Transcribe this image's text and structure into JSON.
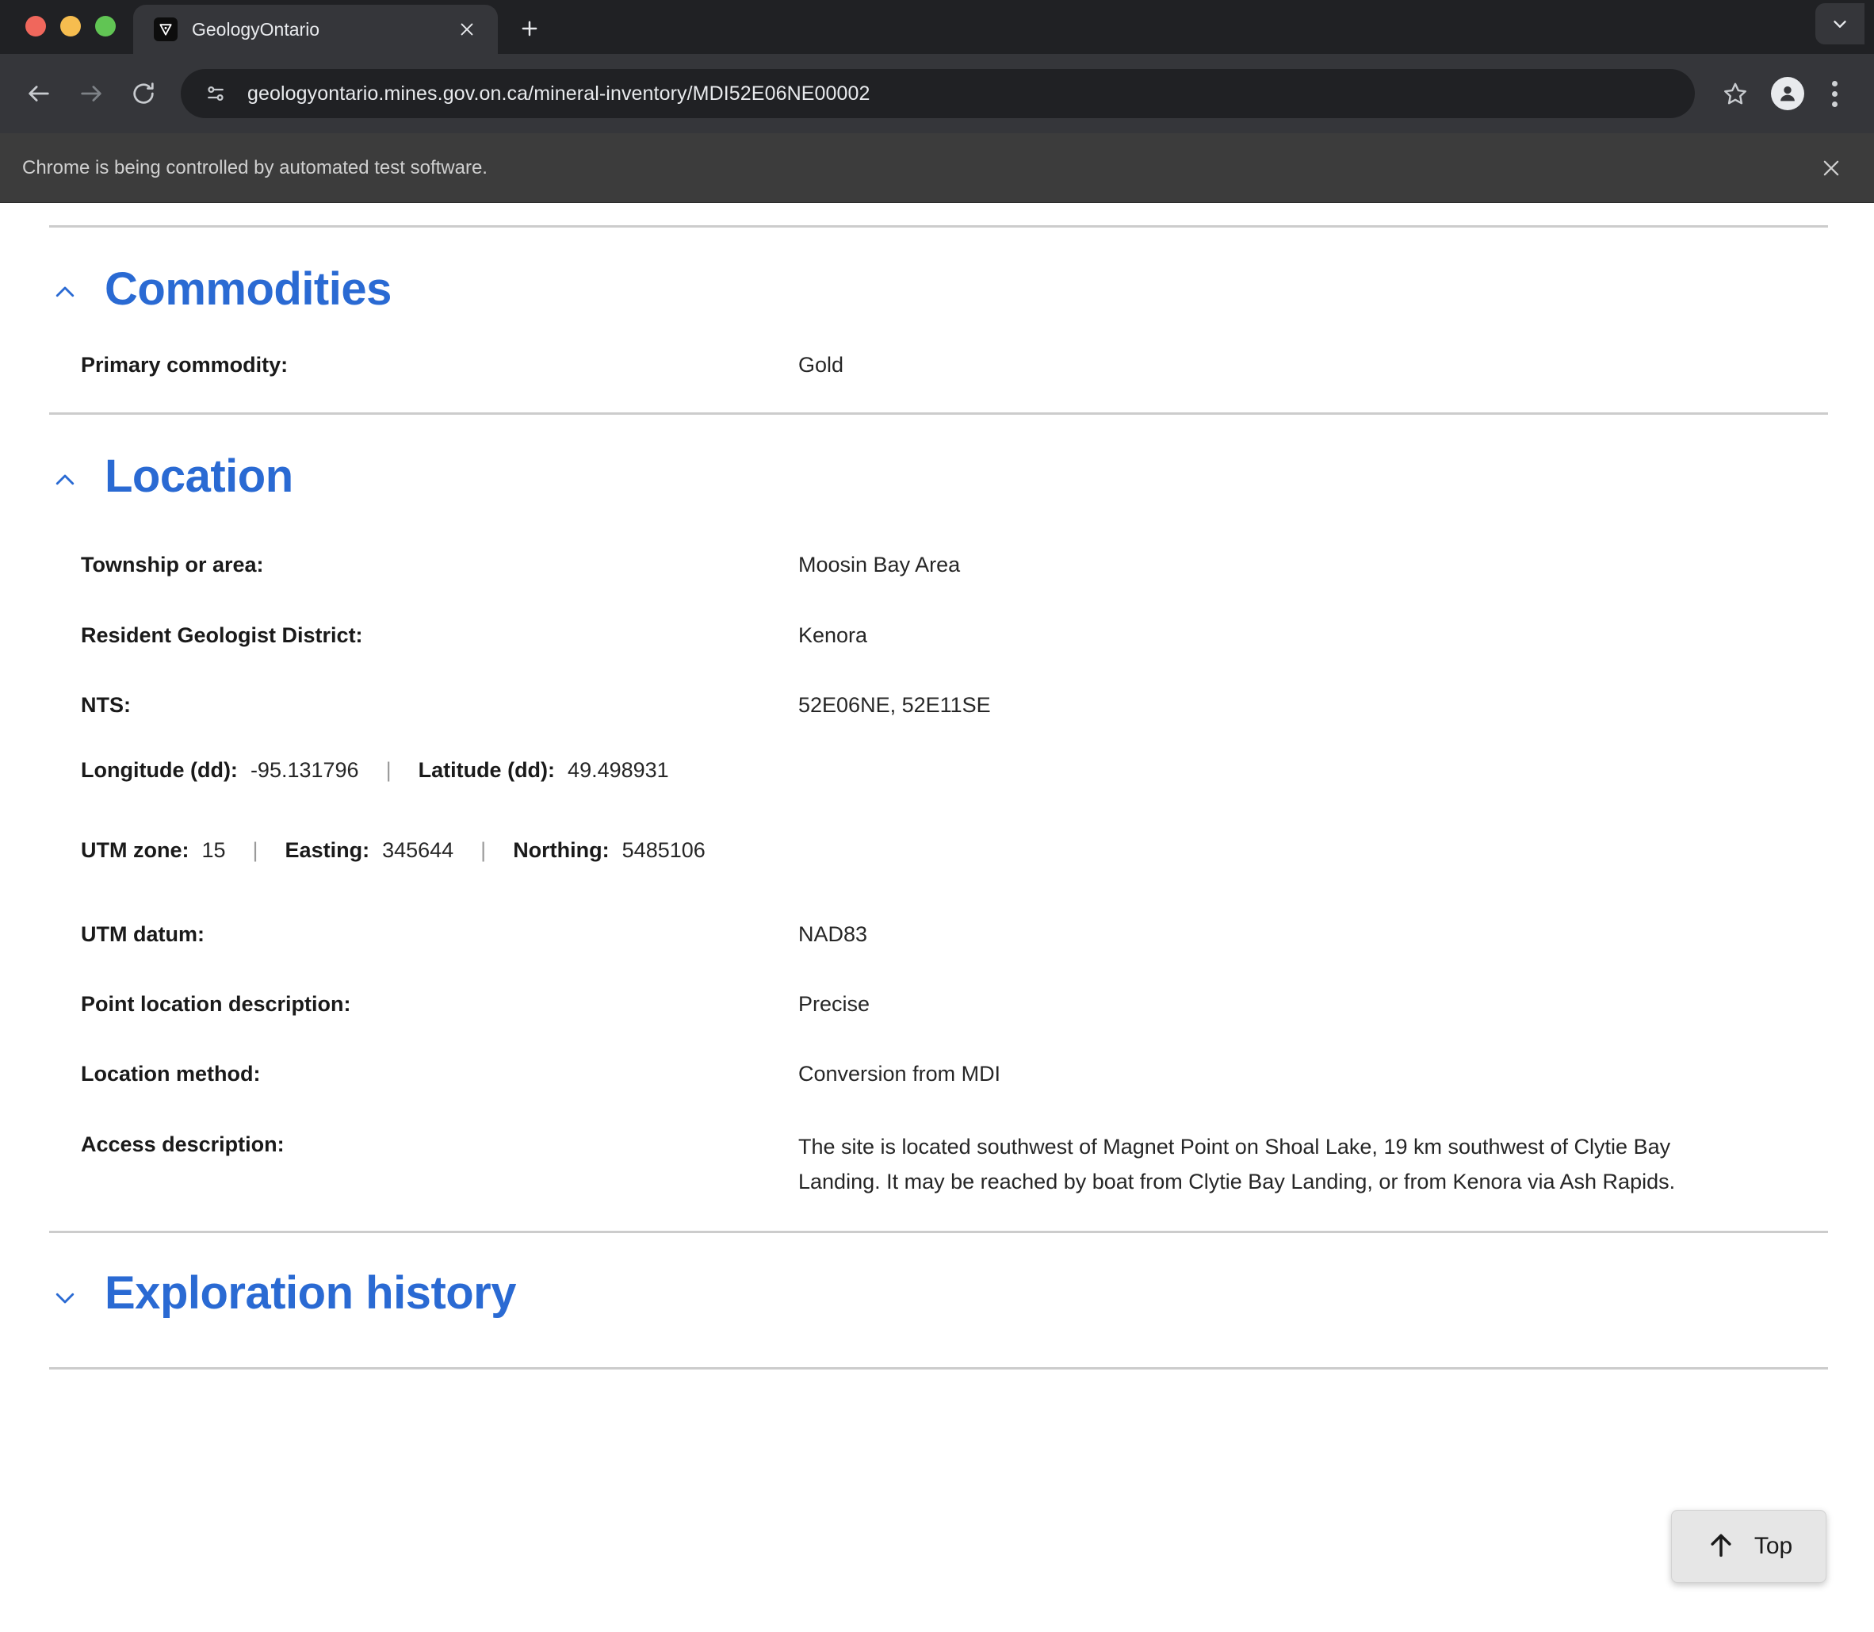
{
  "browser": {
    "tab": {
      "title": "GeologyOntario",
      "favicon_icon": "geology-ontario-favicon",
      "close_icon": "close-icon"
    },
    "new_tab_icon": "plus-icon",
    "tab_search_icon": "chevron-down-icon",
    "nav": {
      "back_icon": "back-arrow-icon",
      "forward_icon": "forward-arrow-icon",
      "reload_icon": "reload-icon"
    },
    "omnibox": {
      "site_info_icon": "site-settings-icon",
      "url": "geologyontario.mines.gov.on.ca/mineral-inventory/MDI52E06NE00002",
      "bookmark_icon": "star-icon"
    },
    "profile_icon": "profile-avatar-icon",
    "menu_icon": "kebab-menu-icon",
    "infobar": {
      "message": "Chrome is being controlled by automated test software.",
      "close_icon": "close-icon"
    }
  },
  "page": {
    "sections": [
      {
        "id": "commodities",
        "title": "Commodities",
        "expanded": true,
        "toggle_icon": "chevron-up-icon",
        "rows": [
          {
            "label": "Primary commodity:",
            "value": "Gold"
          }
        ]
      },
      {
        "id": "location",
        "title": "Location",
        "expanded": true,
        "toggle_icon": "chevron-up-icon",
        "rows": [
          {
            "label": "Township or area:",
            "value": "Moosin Bay Area"
          },
          {
            "label": "Resident Geologist District:",
            "value": "Kenora"
          },
          {
            "label": "NTS:",
            "value": "52E06NE, 52E11SE"
          }
        ],
        "coordinates": {
          "longitude_label": "Longitude (dd):",
          "longitude_value": "-95.131796",
          "separator": "|",
          "latitude_label": "Latitude (dd):",
          "latitude_value": "49.498931"
        },
        "utm": {
          "zone_label": "UTM zone:",
          "zone_value": "15",
          "separator": "|",
          "easting_label": "Easting:",
          "easting_value": "345644",
          "northing_label": "Northing:",
          "northing_value": "5485106"
        },
        "rows_after": [
          {
            "label": "UTM datum:",
            "value": "NAD83"
          },
          {
            "label": "Point location description:",
            "value": "Precise"
          },
          {
            "label": "Location method:",
            "value": "Conversion from MDI"
          },
          {
            "label": "Access description:",
            "value": "The site is located southwest of Magnet Point on Shoal Lake, 19 km southwest of Clytie Bay Landing. It may be reached by boat from Clytie Bay Landing, or from Kenora via Ash Rapids."
          }
        ]
      },
      {
        "id": "exploration-history",
        "title": "Exploration history",
        "expanded": false,
        "toggle_icon": "chevron-down-icon",
        "rows": []
      }
    ],
    "top_button": {
      "label": "Top",
      "icon": "arrow-up-icon"
    }
  },
  "colors": {
    "heading_blue": "#2a6ad3",
    "chrome_dark": "#35363a",
    "tabstrip_dark": "#202124",
    "infobar_dark": "#3c3c3c"
  }
}
